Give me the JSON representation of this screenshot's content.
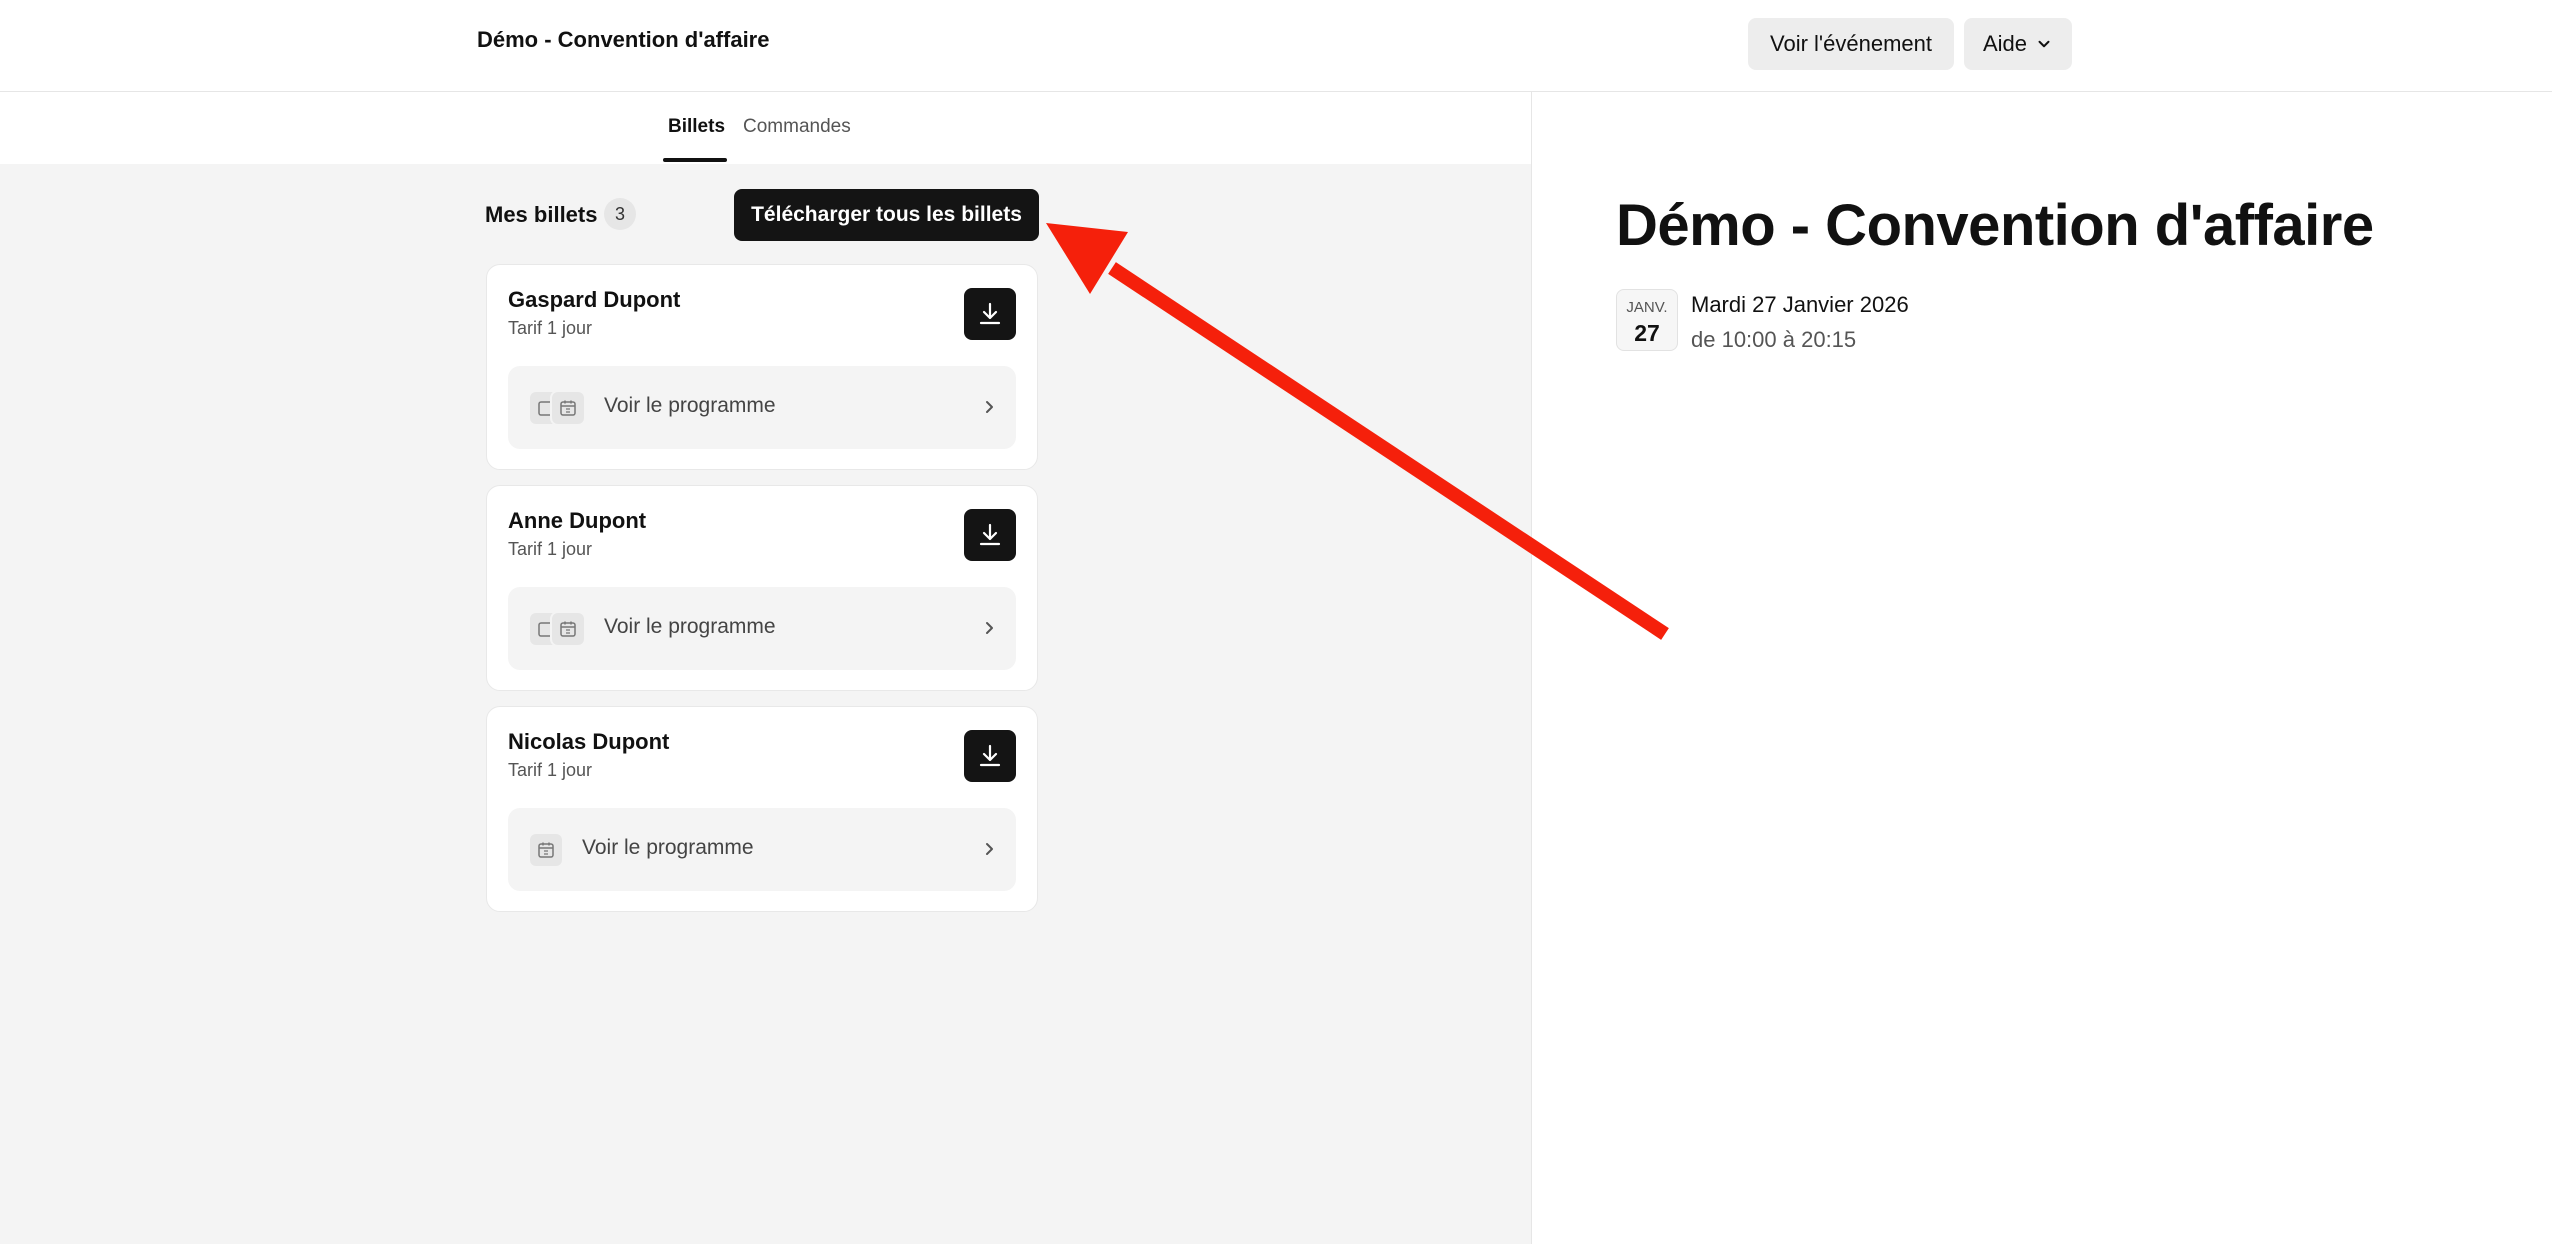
{
  "header": {
    "app_title": "Démo - Convention d'affaire",
    "view_event_label": "Voir l'événement",
    "help_label": "Aide"
  },
  "tabs": [
    {
      "label": "Billets",
      "active": true
    },
    {
      "label": "Commandes",
      "active": false
    }
  ],
  "tickets_section": {
    "title": "Mes billets",
    "count": "3",
    "download_all_label": "Télécharger tous les billets"
  },
  "tickets": [
    {
      "name": "Gaspard Dupont",
      "tarif": "Tarif 1 jour",
      "program_label": "Voir le programme"
    },
    {
      "name": "Anne Dupont",
      "tarif": "Tarif 1 jour",
      "program_label": "Voir le programme"
    },
    {
      "name": "Nicolas Dupont",
      "tarif": "Tarif 1 jour",
      "program_label": "Voir le programme"
    }
  ],
  "event": {
    "title": "Démo - Convention d'affaire",
    "month": "JANV.",
    "day": "27",
    "date_text": "Mardi 27 Janvier 2026",
    "time_text": "de 10:00 à 20:15"
  },
  "colors": {
    "accent_dark": "#141414",
    "panel_bg": "#f4f4f4",
    "annotation_arrow": "#f5200b"
  },
  "icons": [
    "chevron-down-icon",
    "download-icon",
    "calendar-icon",
    "chevron-right-icon",
    "arrow-annotation"
  ]
}
